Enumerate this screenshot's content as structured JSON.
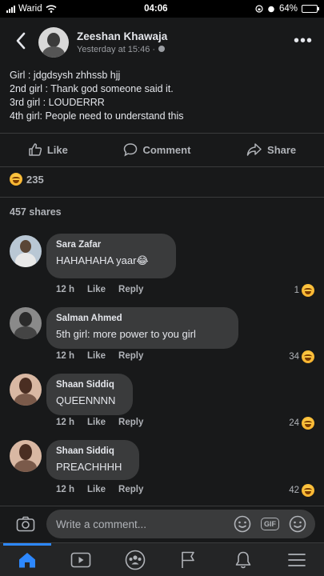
{
  "status": {
    "carrier": "Warid",
    "time": "04:06",
    "battery": "64%",
    "battery_level": 0.64
  },
  "post": {
    "author": "Zeeshan Khawaja",
    "time": "Yesterday at 15:46",
    "lines": [
      "Girl : jdgdsysh zhhssb hjj",
      "2nd girl : Thank god someone said it.",
      "3rd girl : LOUDERRR",
      "4th girl: People need to understand this"
    ],
    "actions": {
      "like": "Like",
      "comment": "Comment",
      "share": "Share"
    },
    "reaction_count": "235",
    "shares": "457 shares"
  },
  "comments": [
    {
      "name": "Sara Zafar",
      "text": "HAHAHAHA yaar😂",
      "time": "12 h",
      "like": "Like",
      "reply": "Reply",
      "reactions": "1"
    },
    {
      "name": "Salman Ahmed",
      "text": "5th girl: more power to you girl",
      "time": "12 h",
      "like": "Like",
      "reply": "Reply",
      "reactions": "34"
    },
    {
      "name": "Shaan Siddiq",
      "text": "QUEENNNN",
      "time": "12 h",
      "like": "Like",
      "reply": "Reply",
      "reactions": "24"
    },
    {
      "name": "Shaan Siddiq",
      "text": "PREACHHHH",
      "time": "12 h",
      "like": "Like",
      "reply": "Reply",
      "reactions": "42"
    }
  ],
  "composer": {
    "placeholder": "Write a comment...",
    "gif_label": "GIF"
  },
  "icons": {
    "back": "back-arrow-icon",
    "more": "more-icon",
    "globe": "globe-icon",
    "like": "thumbs-up-icon",
    "comment": "comment-icon",
    "share": "share-icon",
    "reaction": "laugh-reaction-icon",
    "camera": "camera-icon",
    "sticker": "sticker-icon",
    "gif": "gif-icon",
    "emoji": "emoji-icon",
    "home": "home-icon",
    "watch": "watch-icon",
    "groups": "groups-icon",
    "pages": "flag-icon",
    "notifications": "bell-icon",
    "menu": "menu-icon"
  },
  "colors": {
    "background": "#18191a",
    "bubble": "#3a3b3c",
    "accent": "#2d88ff",
    "text": "#e4e6eb",
    "muted": "#b0b3b8"
  }
}
